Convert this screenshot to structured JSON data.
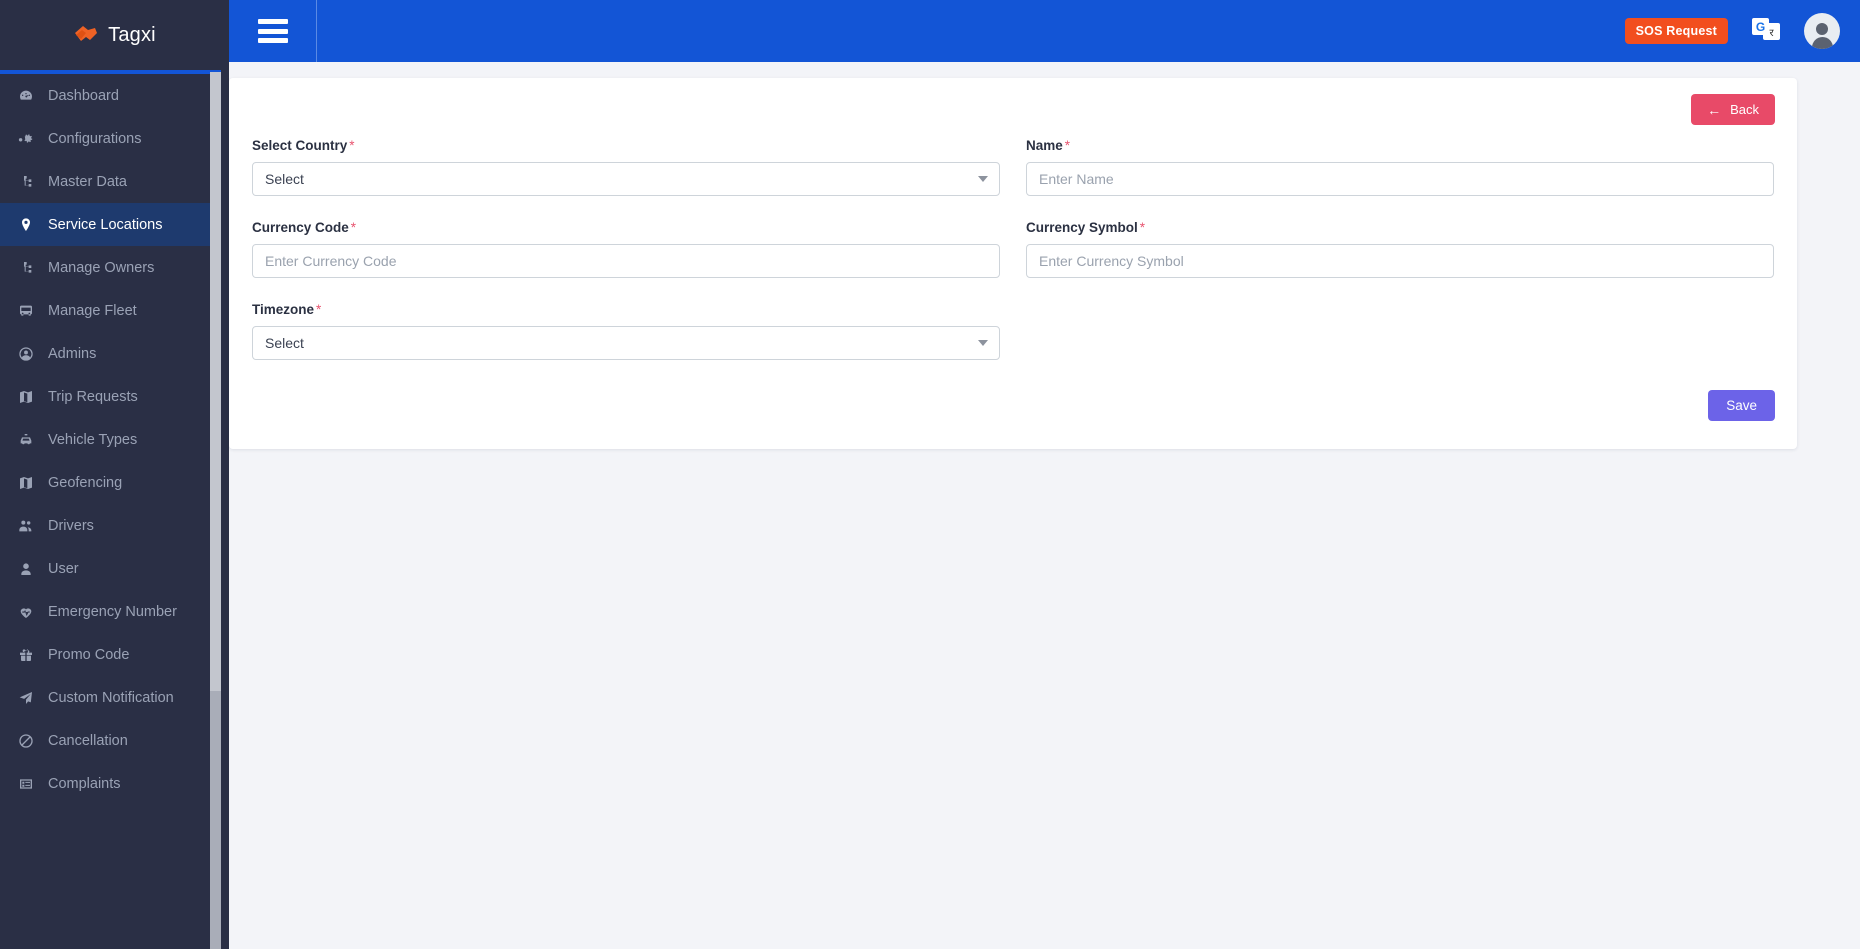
{
  "brand": {
    "name": "Tagxi",
    "logo_icon": "handshake-icon"
  },
  "topbar": {
    "menu_icon": "hamburger-menu-icon",
    "sos_label": "SOS Request",
    "translate_icon": "google-translate-icon",
    "translate_front_text": "G",
    "translate_back_text": "र",
    "avatar_icon": "user-avatar-icon",
    "bg_color": "#1355d6",
    "sos_color": "#f24e1e"
  },
  "sidebar": {
    "bg_color": "#2a2f45",
    "active_color": "#1e3a6e",
    "items": [
      {
        "label": "Dashboard",
        "icon": "dashboard-icon",
        "caret": "",
        "active": false
      },
      {
        "label": "Configurations",
        "icon": "gears-icon",
        "caret": "›",
        "active": false
      },
      {
        "label": "Master Data",
        "icon": "sitemap-icon",
        "caret": "›",
        "active": false
      },
      {
        "label": "Service Locations",
        "icon": "map-pin-icon",
        "caret": "",
        "active": true
      },
      {
        "label": "Manage Owners",
        "icon": "sitemap-icon",
        "caret": "›",
        "active": false
      },
      {
        "label": "Manage Fleet",
        "icon": "bus-icon",
        "caret": "",
        "active": false
      },
      {
        "label": "Admins",
        "icon": "user-circle-icon",
        "caret": "",
        "active": false
      },
      {
        "label": "Trip Requests",
        "icon": "map-icon",
        "caret": "›",
        "active": false
      },
      {
        "label": "Vehicle Types",
        "icon": "taxi-icon",
        "caret": "",
        "active": false
      },
      {
        "label": "Geofencing",
        "icon": "map-icon",
        "caret": "›",
        "active": false
      },
      {
        "label": "Drivers",
        "icon": "users-icon",
        "caret": "›",
        "active": false
      },
      {
        "label": "User",
        "icon": "user-icon",
        "caret": "›",
        "active": false
      },
      {
        "label": "Emergency Number",
        "icon": "heartbeat-icon",
        "caret": "",
        "active": false
      },
      {
        "label": "Promo Code",
        "icon": "gift-icon",
        "caret": "",
        "active": false
      },
      {
        "label": "Custom Notification",
        "icon": "paper-plane-icon",
        "caret": "›",
        "active": false
      },
      {
        "label": "Cancellation",
        "icon": "ban-icon",
        "caret": "",
        "active": false
      },
      {
        "label": "Complaints",
        "icon": "list-icon",
        "caret": "›",
        "active": false
      }
    ]
  },
  "form": {
    "back_label": "Back",
    "back_icon": "arrow-left-icon",
    "back_color": "#e84a68",
    "save_label": "Save",
    "save_color": "#6c63e8",
    "fields": {
      "country": {
        "label": "Select Country",
        "required": "*",
        "value": "Select",
        "type": "select"
      },
      "name": {
        "label": "Name",
        "required": "*",
        "placeholder": "Enter Name",
        "value": "",
        "type": "text"
      },
      "currency_code": {
        "label": "Currency Code",
        "required": "*",
        "placeholder": "Enter Currency Code",
        "value": "",
        "type": "text"
      },
      "currency_symbol": {
        "label": "Currency Symbol",
        "required": "*",
        "placeholder": "Enter Currency Symbol",
        "value": "",
        "type": "text"
      },
      "timezone": {
        "label": "Timezone",
        "required": "*",
        "value": "Select",
        "type": "select"
      }
    }
  }
}
